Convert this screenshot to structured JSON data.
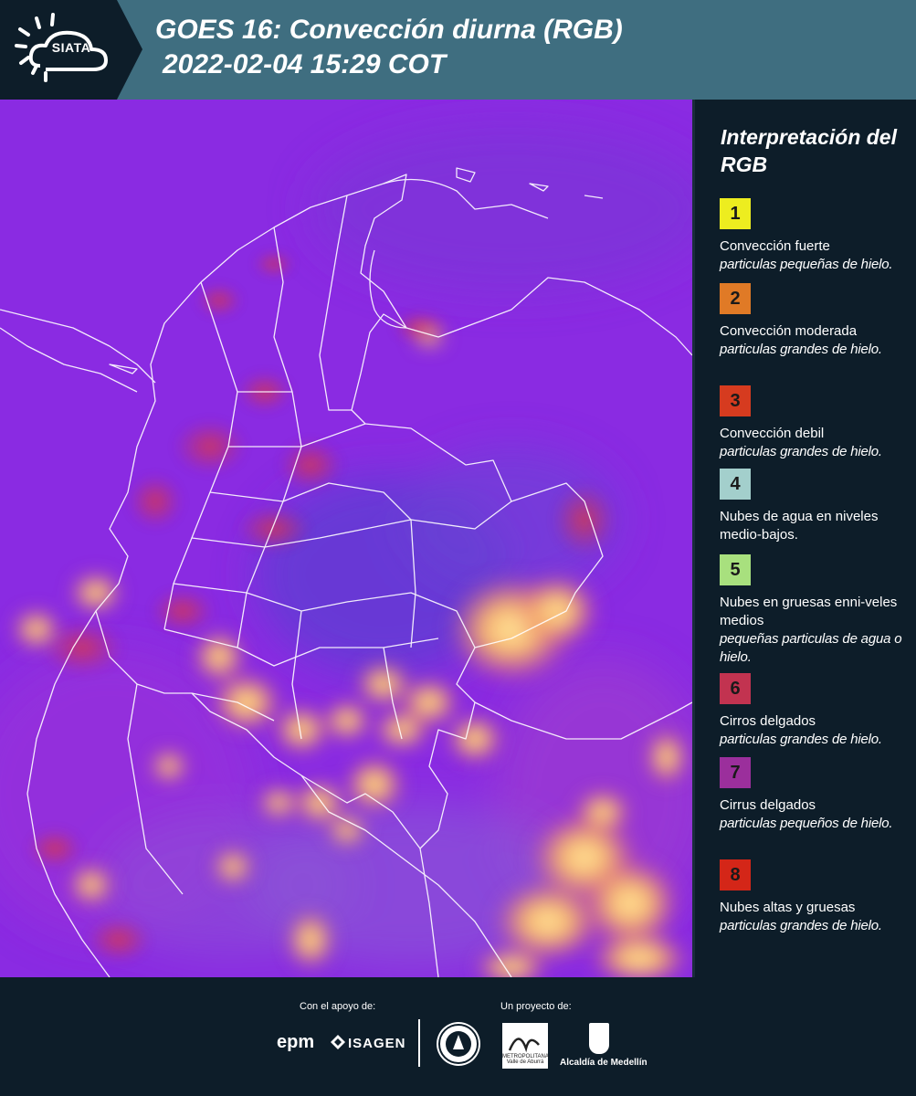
{
  "header": {
    "logo_text": "SIATA",
    "title_line1": "GOES 16: Convección diurna (RGB)",
    "title_line2": "2022-02-04 15:29 COT"
  },
  "legend": {
    "title": "Interpretación del RGB",
    "items": [
      {
        "number": "1",
        "color": "#eded1f",
        "label": "Convección fuerte",
        "sublabel": "particulas pequeñas de hielo."
      },
      {
        "number": "2",
        "color": "#e07a26",
        "label": "Convección moderada",
        "sublabel": "particulas grandes de hielo."
      },
      {
        "number": "3",
        "color": "#d63b1f",
        "label": "Convección debil",
        "sublabel": "particulas grandes de hielo."
      },
      {
        "number": "4",
        "color": "#a3cfcc",
        "label": "Nubes de agua en niveles medio-bajos.",
        "sublabel": ""
      },
      {
        "number": "5",
        "color": "#a8e07e",
        "label": "Nubes en gruesas enni-veles medios",
        "sublabel": "pequeñas particulas de agua o hielo."
      },
      {
        "number": "6",
        "color": "#c23350",
        "label": "Cirros delgados",
        "sublabel": "particulas grandes de hielo."
      },
      {
        "number": "7",
        "color": "#9b2f9c",
        "label": "Cirrus delgados",
        "sublabel": "particulas pequeños de hielo."
      },
      {
        "number": "8",
        "color": "#d42618",
        "label": "Nubes altas y gruesas",
        "sublabel": "particulas grandes de hielo."
      }
    ]
  },
  "footer": {
    "support_label": "Con el apoyo de:",
    "project_label": "Un proyecto de:",
    "sponsor1": "epm",
    "sponsor2": "ISAGEN",
    "partner_area_text": "METROPOLITANA Valle de Aburrá",
    "partner_alcaldia": "Alcaldía de Medellín"
  },
  "colors": {
    "header_bg": "#3f6e80",
    "panel_bg": "#0d1d29",
    "map_base": "#8a2be2"
  }
}
